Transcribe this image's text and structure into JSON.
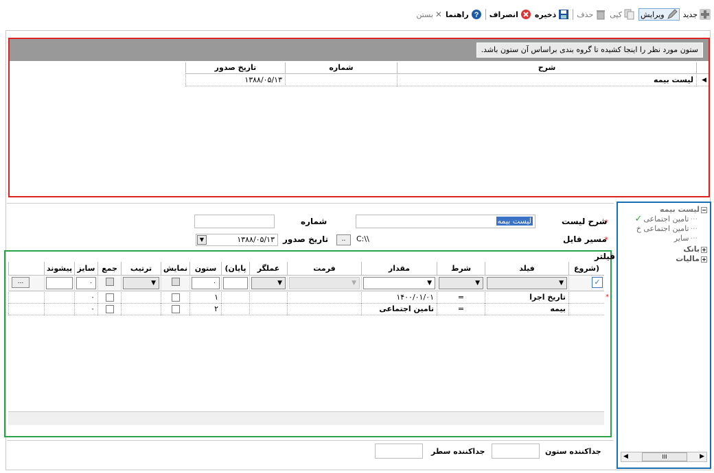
{
  "toolbar": {
    "new": "جدید",
    "edit": "ویرایش",
    "copy": "کپی",
    "delete": "حذف",
    "save": "ذخیره",
    "cancel": "انصراف",
    "help": "راهنما",
    "close": "بستن"
  },
  "group_hint": "ستون مورد نظر را اینجا کشیده تا گروه بندی براساس آن ستون باشد.",
  "top_grid": {
    "columns": [
      "شرح",
      "شماره",
      "تاریخ صدور"
    ],
    "rows": [
      {
        "desc": "لیست بیمه",
        "number": "",
        "date": "۱۳۸۸/۰۵/۱۳"
      }
    ]
  },
  "tree": {
    "root": "لیست بیمه",
    "children": [
      "تامین اجتماعی",
      "تامین اجتماعی خ",
      "سایر"
    ],
    "siblings": [
      "بانک",
      "مالیات"
    ]
  },
  "form": {
    "list_desc_label": "شرح لیست",
    "list_desc_value": "لیست بیمه",
    "number_label": "شماره",
    "number_value": "",
    "file_path_label": "مسیر فایل",
    "file_path_value": "C:\\\\",
    "browse_label": "..",
    "issue_date_label": "تاریخ صدور",
    "issue_date_value": "۱۳۸۸/۰۵/۱۳"
  },
  "filter": {
    "title": "فیلتر",
    "columns": [
      "(شروع",
      "فیلد",
      "شرط",
      "مقدار",
      "فرمت",
      "عملگر",
      "پایان)",
      "ستون",
      "نمایش",
      "ترتیب",
      "جمع",
      "سایز",
      "پیشوند"
    ],
    "filter_row": {
      "column_value": "۰",
      "size_value": "۰",
      "more_label": "..."
    },
    "rows": [
      {
        "field": "تاریخ اجرا",
        "condition": "=",
        "value": "۱۴۰۰/۰۱/۰۱",
        "column": "۱",
        "size": "۰"
      },
      {
        "field": "بیمه",
        "condition": "=",
        "value": "تامین اجتماعی",
        "column": "۲",
        "size": "۰"
      }
    ]
  },
  "bottom": {
    "col_sep_label": "جداکننده ستون",
    "row_sep_label": "جداکننده سطر",
    "col_sep_value": "",
    "row_sep_value": ""
  },
  "scrollbar": {
    "grip": "III"
  },
  "colors": {
    "red_box": "#dd2222",
    "blue_box": "#1a6fb3",
    "green_box": "#2aa14a",
    "group_bar": "#999999"
  }
}
